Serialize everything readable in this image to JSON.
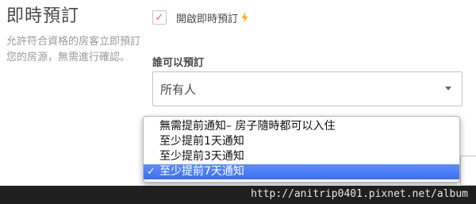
{
  "section": {
    "title": "即時預訂",
    "description": "允許符合資格的房客立即預訂您的房源，無需進行確認。"
  },
  "instant_book": {
    "checkbox_mark": "✓",
    "label": "開啟即時預訂",
    "bolt_icon": "lightning-bolt-icon",
    "bolt_color": "#ffb400"
  },
  "who_can_book": {
    "label": "誰可以預訂",
    "selected_value": "所有人"
  },
  "notice_dropdown": {
    "options": [
      "無需提前通知– 房子隨時都可以入住",
      "至少提前1天通知",
      "至少提前3天通知",
      "至少提前7天通知"
    ],
    "selected_mark": "✓",
    "highlight_color": "#3b6ff0"
  },
  "watermark": {
    "text": "http://anitrip0401.pixnet.net/album"
  }
}
